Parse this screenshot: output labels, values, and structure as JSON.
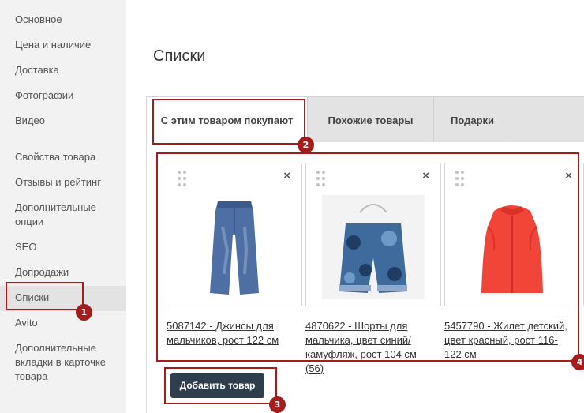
{
  "sidebar": {
    "items": [
      {
        "label": "Основное"
      },
      {
        "label": "Цена и наличие"
      },
      {
        "label": "Доставка"
      },
      {
        "label": "Фотографии"
      },
      {
        "label": "Видео"
      },
      {
        "label": "Свойства товара"
      },
      {
        "label": "Отзывы и рейтинг"
      },
      {
        "label": "Дополнительные опции"
      },
      {
        "label": "SEO"
      },
      {
        "label": "Допродажи"
      },
      {
        "label": "Списки",
        "active": true
      },
      {
        "label": "Avito"
      },
      {
        "label": "Дополнительные вкладки в карточке товара"
      }
    ]
  },
  "main": {
    "title": "Списки",
    "tabs": [
      {
        "label": "С этим товаром покупают",
        "active": true
      },
      {
        "label": "Похожие товары"
      },
      {
        "label": "Подарки"
      }
    ],
    "products": [
      {
        "title": "5087142 - Джинсы для мальчиков, рост 122 см",
        "image": "jeans-image",
        "color": "#4a6fa5"
      },
      {
        "title": "4870622 - Шорты для мальчика, цвет синий/камуфляж, рост 104 см (56)",
        "image": "shorts-image",
        "color": "#3f6b9c"
      },
      {
        "title": "5457790 - Жилет детский, цвет красный, рост 116-122 см",
        "image": "vest-image",
        "color": "#f2453a"
      }
    ],
    "add_button": "Добавить товар"
  },
  "callouts": {
    "badge1": "1",
    "badge2": "2",
    "badge3": "3",
    "badge4": "4",
    "color": "#a51c1c"
  },
  "icons": {
    "close": "×",
    "drag": "drag-handle-icon"
  }
}
